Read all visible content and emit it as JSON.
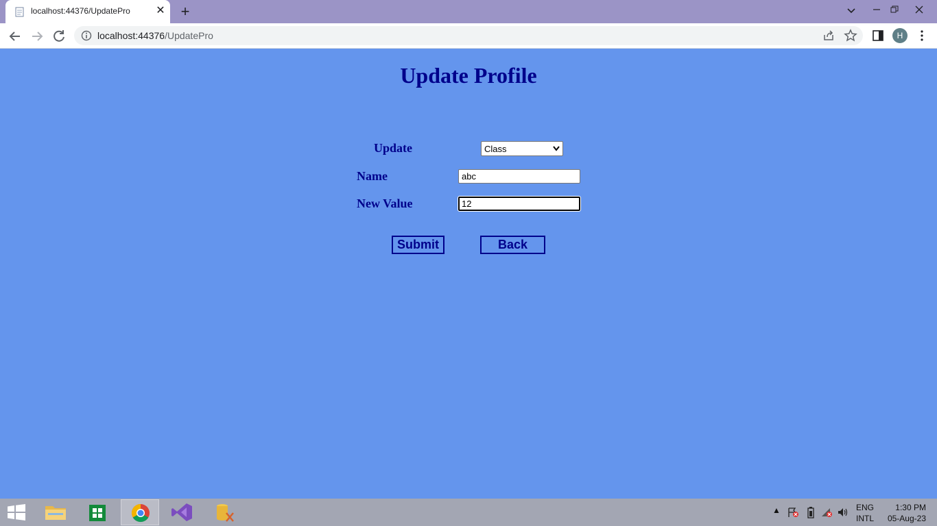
{
  "browser": {
    "tab_title": "localhost:44376/UpdatePro",
    "url_host": "localhost:44376",
    "url_path": "/UpdatePro",
    "profile_initial": "H"
  },
  "page": {
    "title": "Update Profile",
    "form": {
      "update_label": "Update",
      "update_selected": "Class",
      "name_label": "Name",
      "name_value": "abc",
      "new_value_label": "New Value",
      "new_value_value": "12"
    },
    "buttons": {
      "submit": "Submit",
      "back": "Back"
    }
  },
  "taskbar": {
    "language_top": "ENG",
    "language_bottom": "INTL",
    "time": "1:30 PM",
    "date": "05-Aug-23"
  },
  "colors": {
    "page_background": "#6495ED",
    "text_accent": "#00008B"
  }
}
